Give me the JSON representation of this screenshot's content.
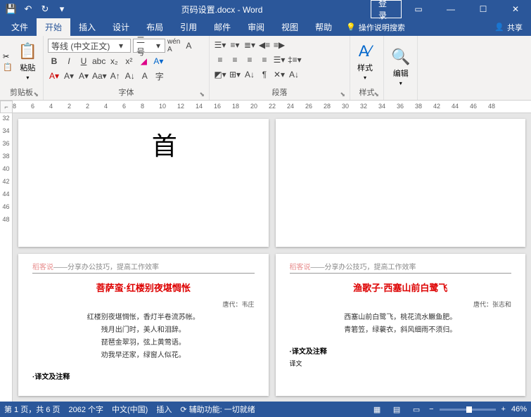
{
  "titlebar": {
    "title": "页码设置.docx - Word",
    "login": "登录"
  },
  "tabs": {
    "file": "文件",
    "home": "开始",
    "insert": "插入",
    "design": "设计",
    "layout": "布局",
    "references": "引用",
    "mailings": "邮件",
    "review": "审阅",
    "view": "视图",
    "help": "帮助",
    "tell": "操作说明搜索",
    "share": "共享"
  },
  "ribbon": {
    "clipboard": {
      "label": "剪贴板",
      "paste": "粘贴"
    },
    "font": {
      "label": "字体",
      "name": "等线 (中文正文)",
      "size": "二号"
    },
    "paragraph": {
      "label": "段落"
    },
    "styles": {
      "label": "样式",
      "btn": "样式"
    },
    "editing": {
      "label": "编辑",
      "btn": "编辑"
    }
  },
  "ruler": {
    "h": [
      "8",
      "6",
      "4",
      "2",
      "2",
      "4",
      "6",
      "8",
      "10",
      "12",
      "14",
      "16",
      "18",
      "20",
      "22",
      "24",
      "26",
      "28",
      "30",
      "32",
      "34",
      "36",
      "38",
      "42",
      "44",
      "46",
      "48"
    ],
    "v": [
      "32",
      "34",
      "36",
      "38",
      "40",
      "42",
      "44",
      "46",
      "48"
    ]
  },
  "pages": {
    "p1": {
      "big": "首"
    },
    "p2": {},
    "p3": {
      "header_brand": "稻客说",
      "header_rest": "——分享办公技巧，提高工作效率",
      "title": "菩萨蛮·红楼别夜堪惆怅",
      "author": "唐代：韦庄",
      "lines": [
        "红楼别夜堪惆怅，香灯半卷流苏帐。",
        "残月出门时，美人和泪辞。",
        "琵琶金翠羽，弦上黄莺语。",
        "劝我早还家，绿窗人似花。"
      ],
      "section": "·译文及注释"
    },
    "p4": {
      "header_brand": "稻客说",
      "header_rest": "——分享办公技巧，提高工作效率",
      "title": "渔歌子·西塞山前白鹭飞",
      "author": "唐代：张志和",
      "lines": [
        "西塞山前白鹭飞，桃花流水鳜鱼肥。",
        "青箬笠，绿蓑衣，斜风细雨不须归。"
      ],
      "section": "·译文及注释",
      "sub": "译文"
    }
  },
  "status": {
    "page": "第 1 页，共 6 页",
    "words": "2062 个字",
    "lang": "中文(中国)",
    "insert": "插入",
    "acc": "辅助功能: 一切就绪",
    "zoom": "46%"
  }
}
